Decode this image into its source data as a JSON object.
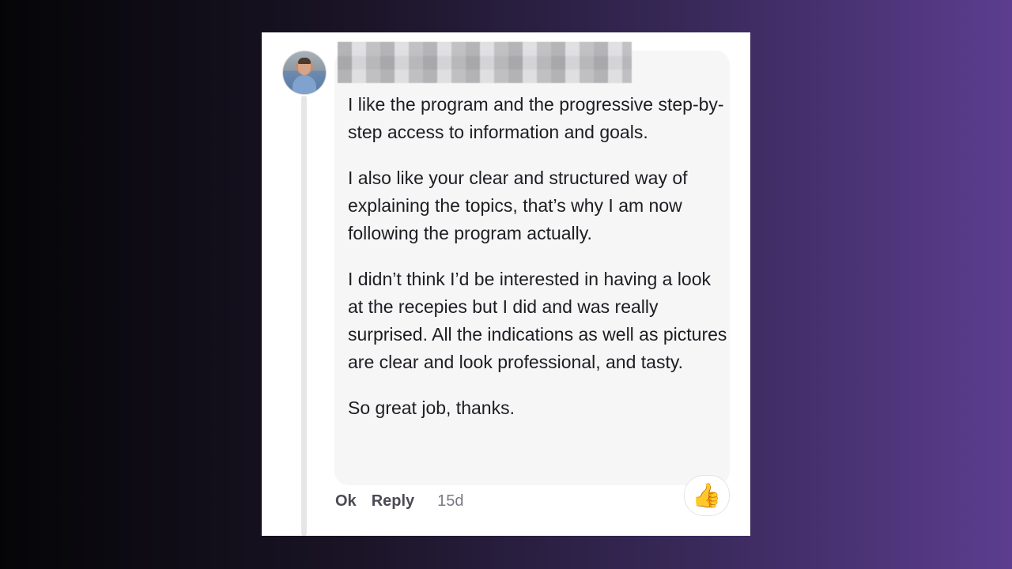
{
  "comment": {
    "paragraphs": [
      "I like the program and the progressive step-by-step access to information and goals.",
      "I also like your clear and structured way of explaining the topics, that’s why I am now following the program actually.",
      "I didn’t think I’d be interested in having a look at the recepies but I did and was really surprised. All the indications as well as pictures are clear and look professional, and tasty.",
      "So great job, thanks."
    ],
    "actions": {
      "ok_label": "Ok",
      "reply_label": "Reply",
      "time": "15d"
    },
    "reaction_icon": "👍"
  }
}
